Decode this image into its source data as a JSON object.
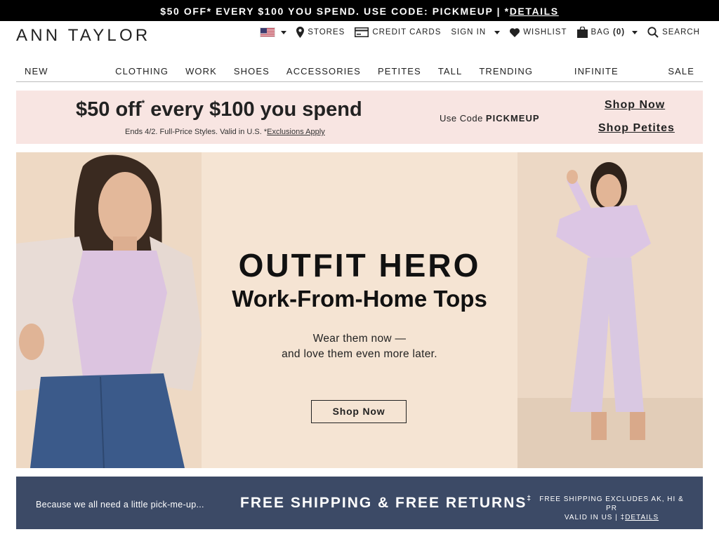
{
  "topbar": {
    "text": "$50 OFF* EVERY $100 YOU SPEND. USE CODE: PICKMEUP | *",
    "details": "DETAILS"
  },
  "logo": "ANN TAYLOR",
  "utility": {
    "stores": "STORES",
    "credit_cards": "CREDIT CARDS",
    "sign_in": "SIGN IN",
    "wishlist": "WISHLIST",
    "bag": "BAG",
    "bag_count": "(0)",
    "search": "SEARCH"
  },
  "nav": [
    "NEW ARRIVALS",
    "CLOTHING",
    "WORK",
    "SHOES",
    "ACCESSORIES",
    "PETITES",
    "TALL",
    "TRENDING NOW",
    "INFINITE STYLE",
    "SALE"
  ],
  "promo": {
    "headline_a": "$50 off",
    "headline_star": "*",
    "headline_b": " every $100 you spend",
    "fine": "Ends 4/2. Full-Price Styles. Valid in U.S. *",
    "exclusions": "Exclusions Apply",
    "code_label": "Use Code ",
    "code": "PICKMEUP",
    "shop_now": "Shop Now",
    "shop_petites": "Shop Petites"
  },
  "hero": {
    "title": "OUTFIT HERO",
    "subtitle": "Work-From-Home Tops",
    "line1": "Wear them now —",
    "line2": "and love them even more later.",
    "button": "Shop Now"
  },
  "shipping": {
    "left": "Because we all need a little pick-me-up...",
    "main": "FREE SHIPPING & FREE RETURNS",
    "main_sup": "‡",
    "right1": "FREE SHIPPING EXCLUDES AK, HI & PR",
    "right2": "VALID IN US | ‡",
    "right_details": "DETAILS"
  },
  "colors": {
    "topbar_bg": "#000000",
    "promo_bg": "#f8e5e2",
    "hero_bg": "#f5e4d3",
    "shipping_bg": "#3c4a66"
  }
}
